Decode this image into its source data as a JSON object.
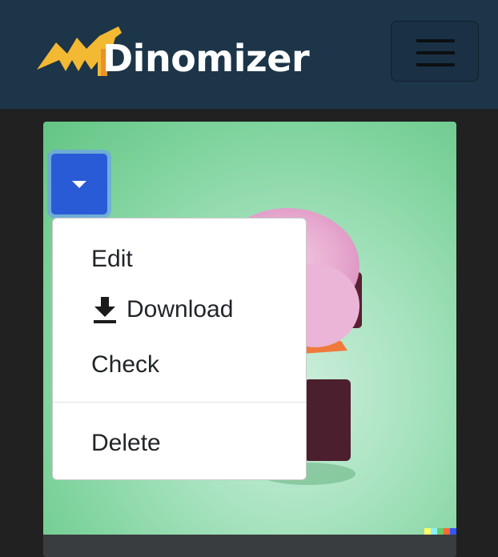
{
  "navbar": {
    "brand_text": "Dinomizer",
    "toggler_icon": "hamburger-icon"
  },
  "card": {
    "dropdown_icon": "caret-down-icon",
    "menu": {
      "items": [
        {
          "label": "Edit"
        },
        {
          "label": "Download",
          "icon": "download-icon"
        },
        {
          "label": "Check"
        },
        {
          "label": "Delete"
        }
      ]
    }
  },
  "colors": {
    "navbar_bg": "#1c3549",
    "page_bg": "#212121",
    "logo_yellow": "#f4b932",
    "dropdown_button": "#2a5bd7"
  }
}
